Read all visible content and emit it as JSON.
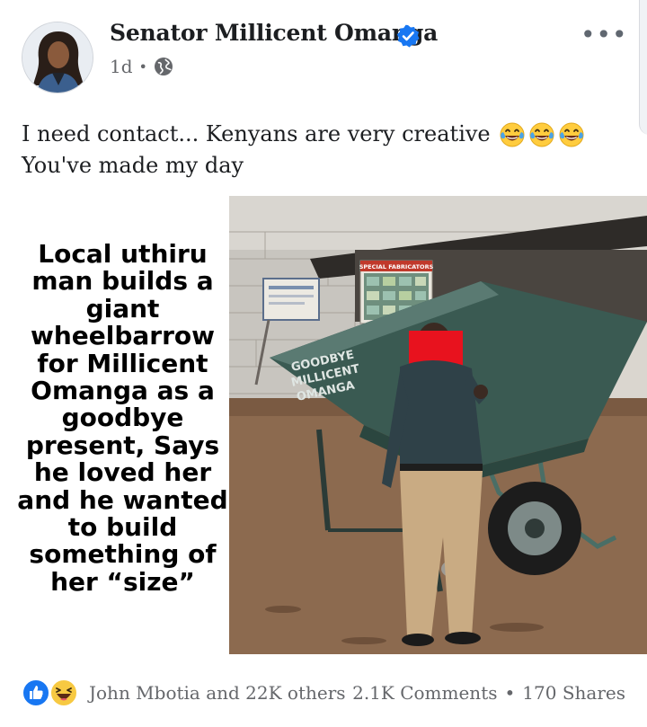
{
  "post": {
    "author": "Senator Millicent Omanga",
    "time": "1d",
    "separator": "•",
    "more_label": "•••",
    "caption_line1": "I need contact... Kenyans are very creative",
    "caption_line2": "You've made my day",
    "caption_emojis": [
      "face-with-tears-of-joy-icon",
      "face-with-tears-of-joy-icon",
      "face-with-tears-of-joy-icon"
    ]
  },
  "image": {
    "headline": "Local uthiru man builds a giant wheelbarrow for Millicent Omanga as a goodbye present, Says he loved her and he wanted to build something of her “size”",
    "barrow_text": [
      "GOODBYE",
      "MILLICENT",
      "OMANGA"
    ],
    "shop_sign": "SPECIAL FABRICATORS"
  },
  "footer": {
    "reactions": [
      "like-icon",
      "haha-icon"
    ],
    "reactors": "John Mbotia and 22K others",
    "comments": "2.1K Comments",
    "separator": "•",
    "shares": "170 Shares"
  },
  "colors": {
    "brand_blue": "#1877f2",
    "text": "#1c1e21",
    "muted": "#65676b",
    "barrow_teal": "#3a5a52",
    "censor_red": "#e8121e"
  }
}
